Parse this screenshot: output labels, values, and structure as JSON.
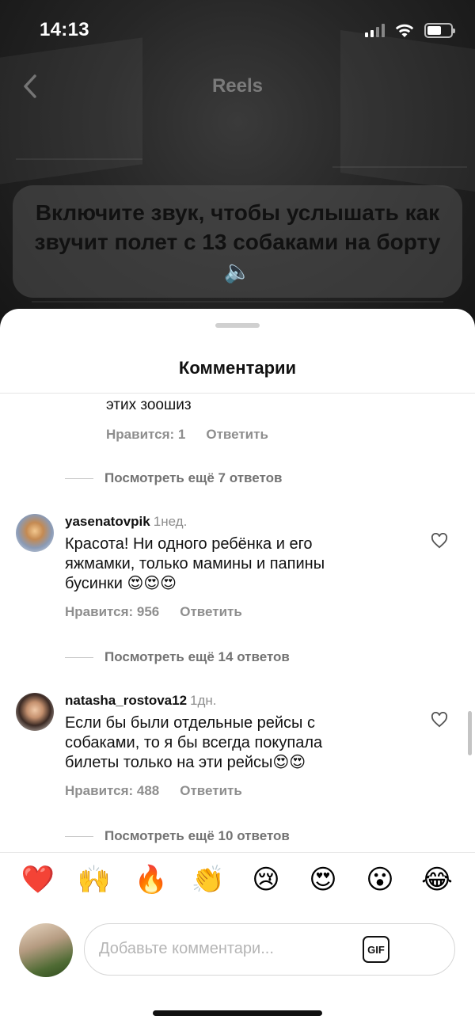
{
  "status_bar": {
    "time": "14:13"
  },
  "header": {
    "title": "Reels"
  },
  "caption": {
    "text": "Включите звук, чтобы услышать как звучит полет с 13 собаками на борту 🔈"
  },
  "sheet": {
    "title": "Комментарии"
  },
  "comments": [
    {
      "text_tail": "этих зоошиз",
      "likes_label": "Нравится: 1",
      "reply_label": "Ответить",
      "view_replies": "Посмотреть ещё 7 ответов"
    },
    {
      "username": "yasenatovpik",
      "ago": "1нед.",
      "text": "Красота! Ни одного ребёнка и его яжмамки,  только мамины и папины бусинки 😍😍😍",
      "likes_label": "Нравится: 956",
      "reply_label": "Ответить",
      "view_replies": "Посмотреть ещё 14 ответов"
    },
    {
      "username": "natasha_rostova12",
      "ago": "1дн.",
      "text": "Если бы были отдельные рейсы с собаками, то я бы всегда покупала билеты только на эти рейсы😍😍",
      "likes_label": "Нравится: 488",
      "reply_label": "Ответить",
      "view_replies": "Посмотреть ещё 10 ответов"
    }
  ],
  "emoji_bar": [
    "❤️",
    "🙌",
    "🔥",
    "👏",
    "😢",
    "😍",
    "😮",
    "😂"
  ],
  "input": {
    "placeholder": "Добавьте комментари...",
    "gif_label": "GIF"
  }
}
